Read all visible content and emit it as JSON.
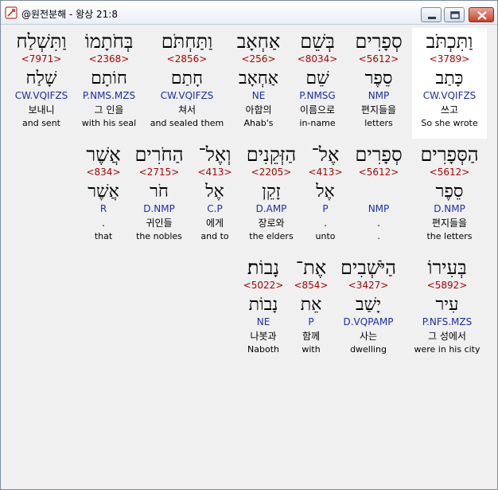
{
  "window": {
    "title": "@원전분해 - 왕상 21:8"
  },
  "rows": [
    {
      "words": [
        {
          "heb": "וַתִּכְתֹּב",
          "strong": "<3789>",
          "lex": "כָּתַב",
          "morph": "CW.VQIFZS",
          "kor": "쓰고",
          "eng": "So she wrote",
          "selected": true
        },
        {
          "heb": "סְפָרִים",
          "strong": "<5612>",
          "lex": "סֵפֶר",
          "morph": "NMP",
          "kor": "편지들을",
          "eng": "letters"
        },
        {
          "heb": "בְּשֵׁם",
          "strong": "<8034>",
          "lex": "שֵׁם",
          "morph": "P.NMSG",
          "kor": "이름으로",
          "eng": "in-name"
        },
        {
          "heb": "אַחְאָב",
          "strong": "<256>",
          "lex": "אַחְאָב",
          "morph": "NE",
          "kor": "아합의",
          "eng": "Ahab's"
        },
        {
          "heb": "וַתַּחְתֹּם",
          "strong": "<2856>",
          "lex": "חָתַם",
          "morph": "CW.VQIFZS",
          "kor": "쳐서",
          "eng": "and sealed them"
        },
        {
          "heb": "בְּחֹתָמוֹ",
          "strong": "<2368>",
          "lex": "חוֹתָם",
          "morph": "P.NMS.MZS",
          "kor": "그 인을",
          "eng": "with his seal"
        },
        {
          "heb": "וַתִּשְׁלַח",
          "strong": "<7971>",
          "lex": "שָׁלַח",
          "morph": "CW.VQIFZS",
          "kor": "보내니",
          "eng": "and sent"
        }
      ]
    },
    {
      "words": [
        {
          "heb": "הַסְּפָרִים",
          "strong": "<5612>",
          "lex": "סֵפֶר",
          "morph": "D.NMP",
          "kor": "편지들을",
          "eng": "the letters"
        },
        {
          "heb": "סְפָרִים",
          "strong": "<5612>",
          "lex": "",
          "morph": "NMP",
          "kor": ".",
          "eng": "."
        },
        {
          "heb": "אֶל־",
          "strong": "<413>",
          "lex": "אֶל",
          "morph": "P",
          "kor": ".",
          "eng": "unto"
        },
        {
          "heb": "הַזְּקֵנִים",
          "strong": "<2205>",
          "lex": "זָקֵן",
          "morph": "D.AMP",
          "kor": "장로와",
          "eng": "the elders"
        },
        {
          "heb": "וְאֶל־",
          "strong": "<413>",
          "lex": "אֶל",
          "morph": "C.P",
          "kor": "에게",
          "eng": "and to"
        },
        {
          "heb": "הַחֹרִים",
          "strong": "<2715>",
          "lex": "חֹר",
          "morph": "D.NMP",
          "kor": "귀인들",
          "eng": "the nobles"
        },
        {
          "heb": "אֲשֶׁר",
          "strong": "<834>",
          "lex": "אֲשֶׁר",
          "morph": "R",
          "kor": ".",
          "eng": "that"
        }
      ]
    },
    {
      "words": [
        {
          "heb": "בְּעִירוֹ",
          "strong": "<5892>",
          "lex": "עִיר",
          "morph": "P.NFS.MZS",
          "kor": "그 성에서",
          "eng": "were in his city"
        },
        {
          "heb": "הַיֹּשְׁבִים",
          "strong": "<3427>",
          "lex": "יָשַׁב",
          "morph": "D.VQPAMP",
          "kor": "사는",
          "eng": "dwelling"
        },
        {
          "heb": "אֶת־",
          "strong": "<854>",
          "lex": "אֵת",
          "morph": "P",
          "kor": "함께",
          "eng": "with"
        },
        {
          "heb": "נָבוֹת׃",
          "strong": "<5022>",
          "lex": "נָבוֹת",
          "morph": "NE",
          "kor": "나봇과",
          "eng": "Naboth"
        }
      ]
    }
  ],
  "colors": {
    "strong": "#b00000",
    "morph": "#1a2eb0"
  }
}
